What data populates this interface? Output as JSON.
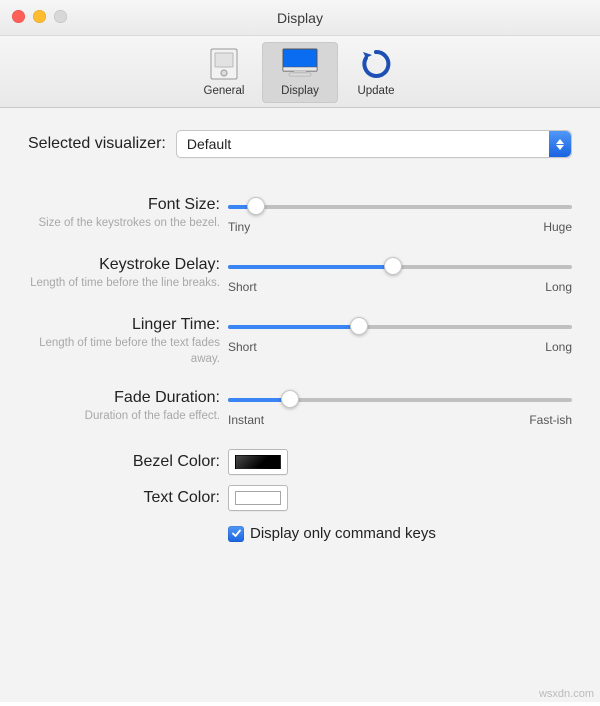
{
  "window": {
    "title": "Display"
  },
  "toolbar": {
    "items": [
      {
        "label": "General"
      },
      {
        "label": "Display"
      },
      {
        "label": "Update"
      }
    ],
    "active_index": 1
  },
  "visualizer": {
    "label": "Selected visualizer:",
    "value": "Default"
  },
  "sliders": {
    "font_size": {
      "label": "Font Size:",
      "help": "Size of the keystrokes on the bezel.",
      "left": "Tiny",
      "right": "Huge",
      "percent": 8
    },
    "key_delay": {
      "label": "Keystroke Delay:",
      "help": "Length of time before the line breaks.",
      "left": "Short",
      "right": "Long",
      "percent": 48
    },
    "linger": {
      "label": "Linger Time:",
      "help": "Length of time before the text fades away.",
      "left": "Short",
      "right": "Long",
      "percent": 38
    },
    "fade": {
      "label": "Fade Duration:",
      "help": "Duration of the fade effect.",
      "left": "Instant",
      "right": "Fast-ish",
      "percent": 18
    }
  },
  "colors": {
    "bezel_label": "Bezel Color:",
    "text_label": "Text Color:",
    "bezel_value": "#000000",
    "text_value": "#ffffff"
  },
  "checkbox": {
    "checked": true,
    "label": "Display only command keys"
  },
  "watermark": "wsxdn.com"
}
